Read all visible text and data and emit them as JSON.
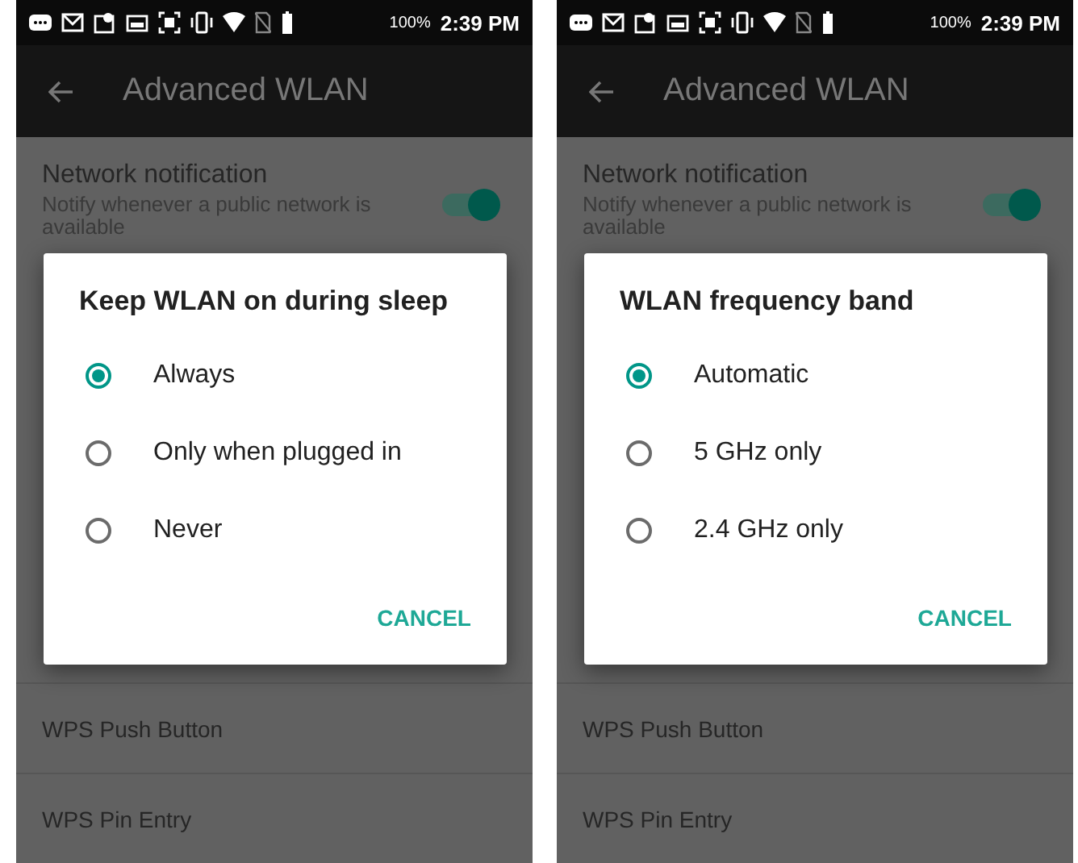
{
  "screens": [
    {
      "status_bar": {
        "battery": "100%",
        "time": "2:39 PM"
      },
      "toolbar": {
        "title": "Advanced WLAN"
      },
      "top_setting": {
        "title": "Network notification",
        "subtitle": "Notify whenever a public network is available",
        "on": true
      },
      "list_items": [
        "WPS Push Button",
        "WPS Pin Entry"
      ],
      "dialog": {
        "title": "Keep WLAN on during sleep",
        "options": [
          {
            "label": "Always",
            "selected": true
          },
          {
            "label": "Only when plugged in",
            "selected": false
          },
          {
            "label": "Never",
            "selected": false
          }
        ],
        "button": "CANCEL"
      }
    },
    {
      "status_bar": {
        "battery": "100%",
        "time": "2:39 PM"
      },
      "toolbar": {
        "title": "Advanced WLAN"
      },
      "top_setting": {
        "title": "Network notification",
        "subtitle": "Notify whenever a public network is available",
        "on": true
      },
      "list_items": [
        "WPS Push Button",
        "WPS Pin Entry"
      ],
      "dialog": {
        "title": "WLAN frequency band",
        "options": [
          {
            "label": "Automatic",
            "selected": true
          },
          {
            "label": "5 GHz only",
            "selected": false
          },
          {
            "label": "2.4 GHz only",
            "selected": false
          }
        ],
        "button": "CANCEL"
      }
    }
  ]
}
